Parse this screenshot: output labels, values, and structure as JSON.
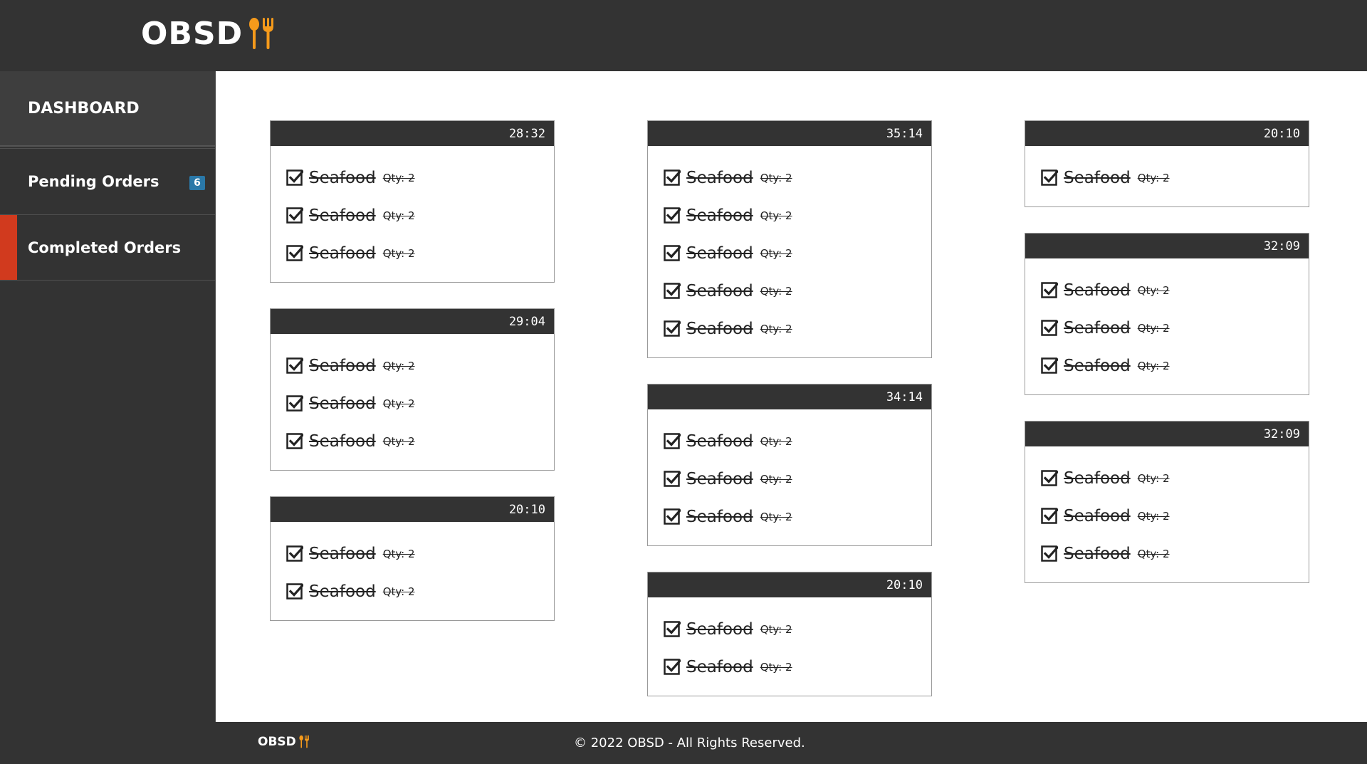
{
  "brand": {
    "name": "OBSD",
    "icon": "fork-spoon-icon",
    "accent": "#f59a1b"
  },
  "sidebar": {
    "dashboard_label": "DASHBOARD",
    "items": [
      {
        "label": "Pending Orders",
        "badge": "6",
        "active": false
      },
      {
        "label": "Completed Orders",
        "active": true,
        "active_color": "#d13a1e"
      }
    ]
  },
  "columns": [
    [
      {
        "time": "28:32",
        "items": [
          {
            "name": "Seafood",
            "qty": "Qty: 2"
          },
          {
            "name": "Seafood",
            "qty": "Qty: 2"
          },
          {
            "name": "Seafood",
            "qty": "Qty: 2"
          }
        ]
      },
      {
        "time": "29:04",
        "items": [
          {
            "name": "Seafood",
            "qty": "Qty: 2"
          },
          {
            "name": "Seafood",
            "qty": "Qty: 2"
          },
          {
            "name": "Seafood",
            "qty": "Qty: 2"
          }
        ]
      },
      {
        "time": "20:10",
        "items": [
          {
            "name": "Seafood",
            "qty": "Qty: 2"
          },
          {
            "name": "Seafood",
            "qty": "Qty: 2"
          }
        ]
      }
    ],
    [
      {
        "time": "35:14",
        "items": [
          {
            "name": "Seafood",
            "qty": "Qty: 2"
          },
          {
            "name": "Seafood",
            "qty": "Qty: 2"
          },
          {
            "name": "Seafood",
            "qty": "Qty: 2"
          },
          {
            "name": "Seafood",
            "qty": "Qty: 2"
          },
          {
            "name": "Seafood",
            "qty": "Qty: 2"
          }
        ]
      },
      {
        "time": "34:14",
        "items": [
          {
            "name": "Seafood",
            "qty": "Qty: 2"
          },
          {
            "name": "Seafood",
            "qty": "Qty: 2"
          },
          {
            "name": "Seafood",
            "qty": "Qty: 2"
          }
        ]
      },
      {
        "time": "20:10",
        "items": [
          {
            "name": "Seafood",
            "qty": "Qty: 2"
          },
          {
            "name": "Seafood",
            "qty": "Qty: 2"
          }
        ]
      }
    ],
    [
      {
        "time": "20:10",
        "items": [
          {
            "name": "Seafood",
            "qty": "Qty: 2"
          }
        ]
      },
      {
        "time": "32:09",
        "items": [
          {
            "name": "Seafood",
            "qty": "Qty: 2"
          },
          {
            "name": "Seafood",
            "qty": "Qty: 2"
          },
          {
            "name": "Seafood",
            "qty": "Qty: 2"
          }
        ]
      },
      {
        "time": "32:09",
        "items": [
          {
            "name": "Seafood",
            "qty": "Qty: 2"
          },
          {
            "name": "Seafood",
            "qty": "Qty: 2"
          },
          {
            "name": "Seafood",
            "qty": "Qty: 2"
          }
        ]
      }
    ]
  ],
  "footer": {
    "brand": "OBSD",
    "copyright": "© 2022 OBSD - All Rights Reserved."
  }
}
